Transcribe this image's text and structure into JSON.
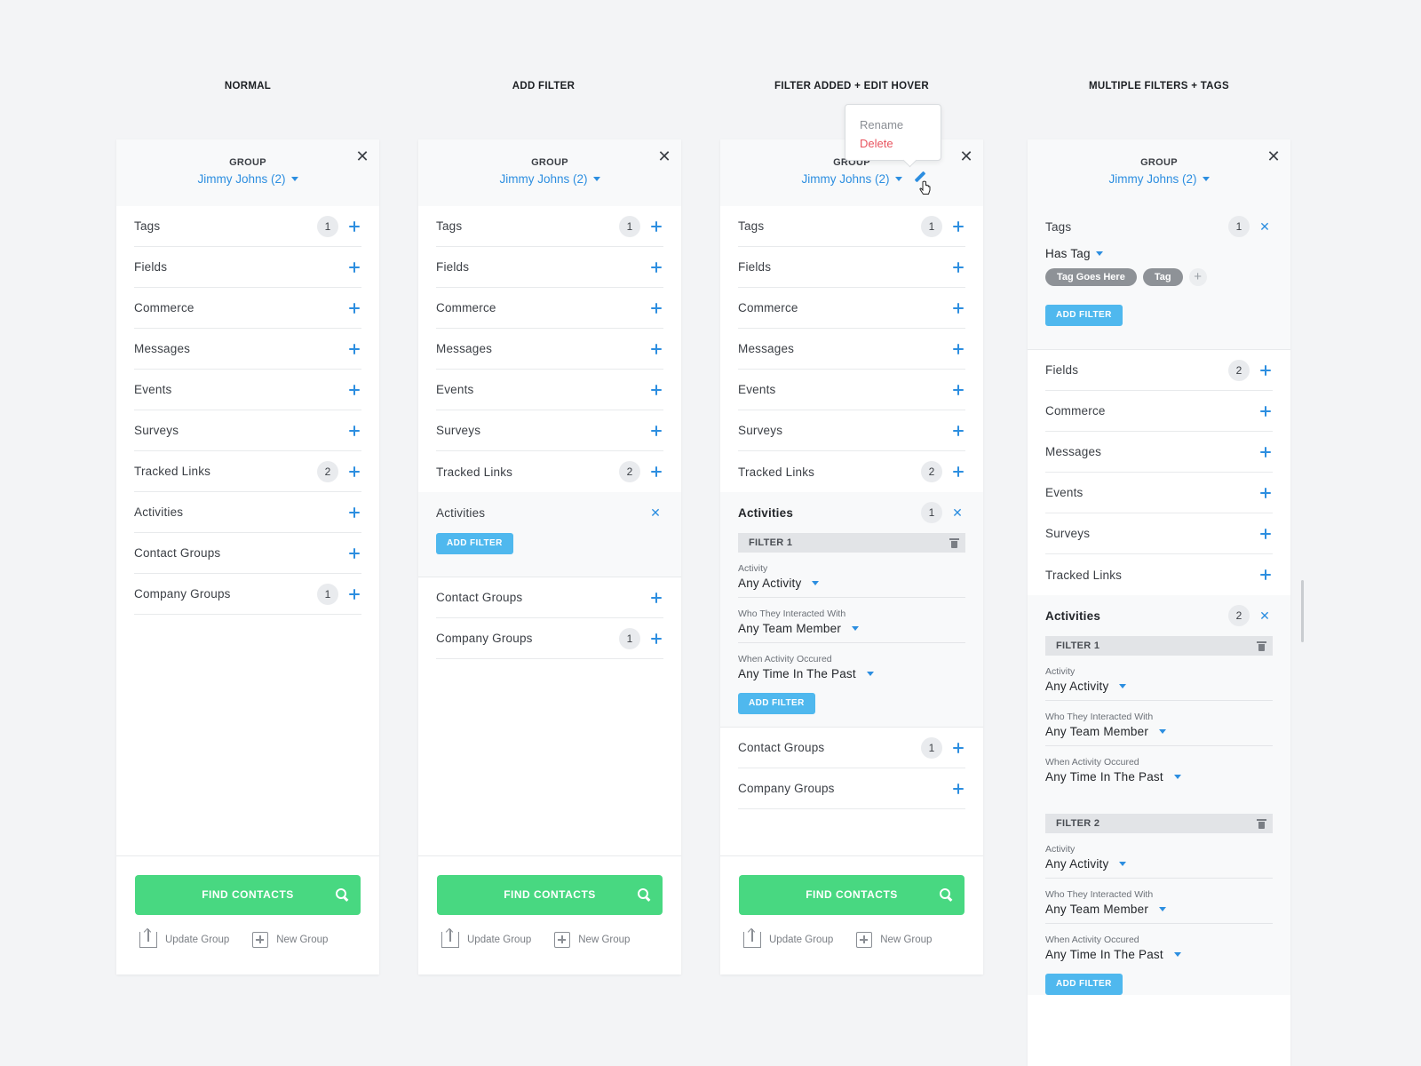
{
  "columns": [
    {
      "title": "NORMAL"
    },
    {
      "title": "ADD FILTER"
    },
    {
      "title": "FILTER ADDED + EDIT HOVER"
    },
    {
      "title": "MULTIPLE FILTERS + TAGS"
    }
  ],
  "header": {
    "group_label": "GROUP",
    "group_value": "Jimmy Johns (2)",
    "close_symbol": "✕"
  },
  "categories": {
    "tags": "Tags",
    "fields": "Fields",
    "commerce": "Commerce",
    "messages": "Messages",
    "events": "Events",
    "surveys": "Surveys",
    "tracked_links": "Tracked Links",
    "activities": "Activities",
    "contact_groups": "Contact Groups",
    "company_groups": "Company Groups"
  },
  "badges": {
    "one": "1",
    "two": "2"
  },
  "add_filter_label": "ADD FILTER",
  "filter": {
    "f1": "FILTER 1",
    "f2": "FILTER 2",
    "activity_label": "Activity",
    "activity_value": "Any Activity",
    "who_label": "Who They Interacted With",
    "who_value": "Any Team Member",
    "when_label": "When Activity Occured",
    "when_value": "Any Time In The Past"
  },
  "tags_filter": {
    "has_tag": "Has Tag",
    "tag1": "Tag Goes Here",
    "tag2": "Tag",
    "add_symbol": "+"
  },
  "footer": {
    "find_contacts": "FIND CONTACTS",
    "update_group": "Update Group",
    "new_group": "New Group"
  },
  "popover": {
    "rename": "Rename",
    "delete": "Delete"
  },
  "colors": {
    "accent": "#2c8ee0",
    "green": "#48d881",
    "danger": "#e8545f",
    "muted": "#8a8e94"
  }
}
